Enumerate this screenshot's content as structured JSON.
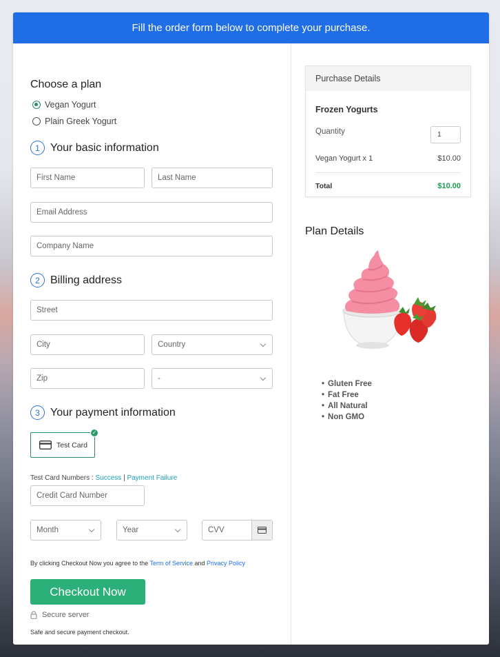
{
  "banner": "Fill the order form below to complete your purchase.",
  "plan": {
    "title": "Choose a plan",
    "options": [
      {
        "label": "Vegan Yogurt",
        "selected": true
      },
      {
        "label": "Plain Greek Yogurt",
        "selected": false
      }
    ]
  },
  "section1": {
    "num": "1",
    "title": "Your basic information",
    "first_name": "First Name",
    "last_name": "Last Name",
    "email": "Email Address",
    "company": "Company Name"
  },
  "section2": {
    "num": "2",
    "title": "Billing address",
    "street": "Street",
    "city": "City",
    "country": "Country",
    "zip": "Zip",
    "state": "-"
  },
  "section3": {
    "num": "3",
    "title": "Your payment information",
    "test_card": "Test Card",
    "card_numbers_label": "Test Card Numbers :",
    "success": "Success",
    "sep": "|",
    "failure": "Payment Failure",
    "card_number": "Credit Card Number",
    "month": "Month",
    "year": "Year",
    "cvv": "CVV"
  },
  "terms": {
    "prefix": "By clicking Checkout Now you agree to the",
    "tos": "Term of Service",
    "and": "and",
    "privacy": "Privacy Policy"
  },
  "checkout_label": "Checkout Now",
  "secure_server": "Secure server",
  "secure_note": "Safe and secure payment checkout.",
  "purchase": {
    "heading": "Purchase Details",
    "product": "Frozen Yogurts",
    "quantity_label": "Quantity",
    "quantity_value": "1",
    "line_item": "Vegan Yogurt x 1",
    "line_price": "$10.00",
    "total_label": "Total",
    "total_value": "$10.00"
  },
  "plan_details": {
    "title": "Plan Details",
    "features": [
      "Gluten Free",
      "Fat Free",
      "All Natural",
      "Non GMO"
    ]
  },
  "colors": {
    "accent": "#1f6ee5",
    "success": "#2bb079",
    "total": "#1a9a4f"
  }
}
